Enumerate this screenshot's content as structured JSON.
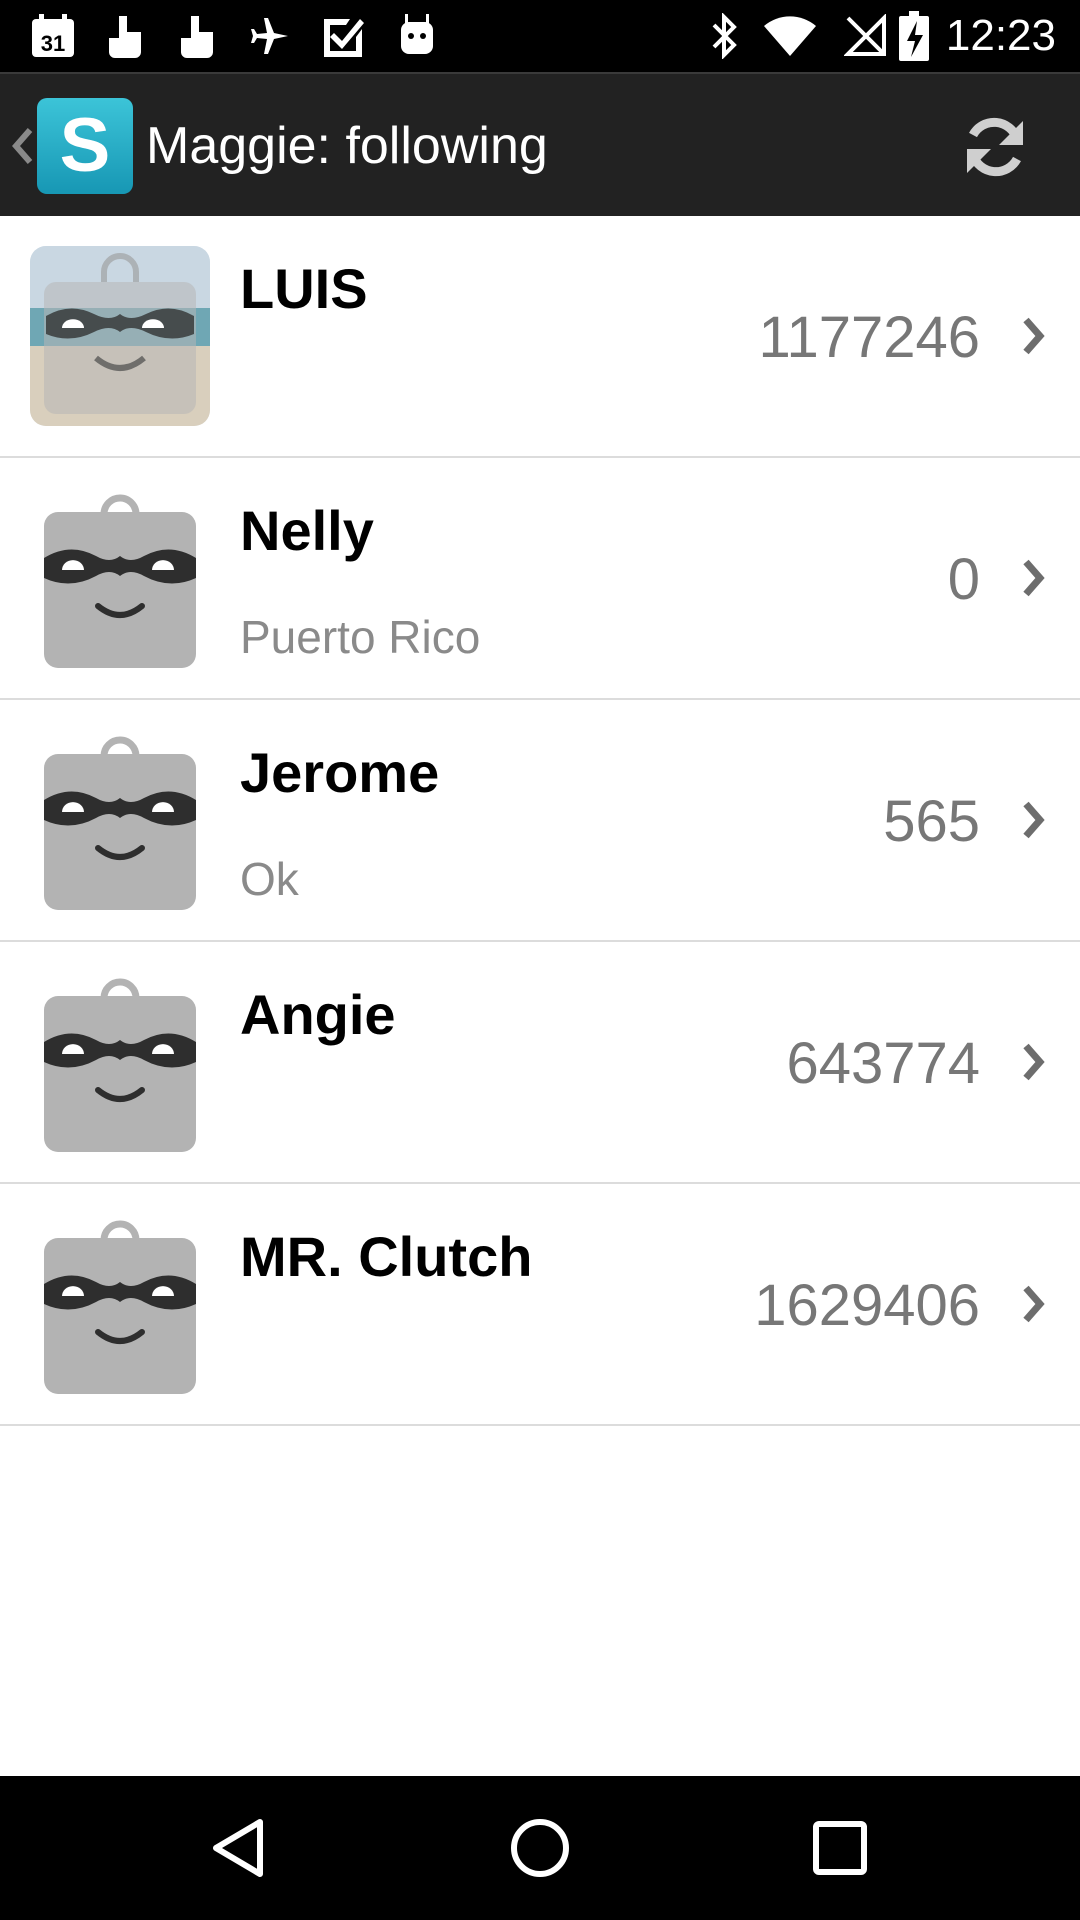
{
  "status_bar": {
    "time": "12:23",
    "calendar_day": "31",
    "left_icons": [
      "calendar-icon",
      "hand-pointer-icon",
      "hand-pointer-icon",
      "airplane-icon",
      "checkbox-icon",
      "android-robot-icon"
    ],
    "right_icons": [
      "bluetooth-icon",
      "wifi-icon",
      "no-signal-icon",
      "battery-charging-icon"
    ]
  },
  "action_bar": {
    "logo_letter": "S",
    "title": "Maggie: following",
    "refresh_icon": "refresh-icon",
    "background": "#222222",
    "logo_color": "#1a9fb8"
  },
  "following": [
    {
      "name": "LUIS",
      "subtitle": "",
      "count": "1177246",
      "avatar": "photo-beach"
    },
    {
      "name": "Nelly",
      "subtitle": "Puerto Rico",
      "count": "0",
      "avatar": "default-bag-mask"
    },
    {
      "name": "Jerome",
      "subtitle": "Ok",
      "count": "565",
      "avatar": "default-bag-mask"
    },
    {
      "name": "Angie",
      "subtitle": "",
      "count": "643774",
      "avatar": "default-bag-mask"
    },
    {
      "name": "MR. Clutch",
      "subtitle": "",
      "count": "1629406",
      "avatar": "default-bag-mask"
    }
  ],
  "nav_bar": {
    "buttons": [
      "back-icon",
      "home-icon",
      "recents-icon"
    ]
  }
}
